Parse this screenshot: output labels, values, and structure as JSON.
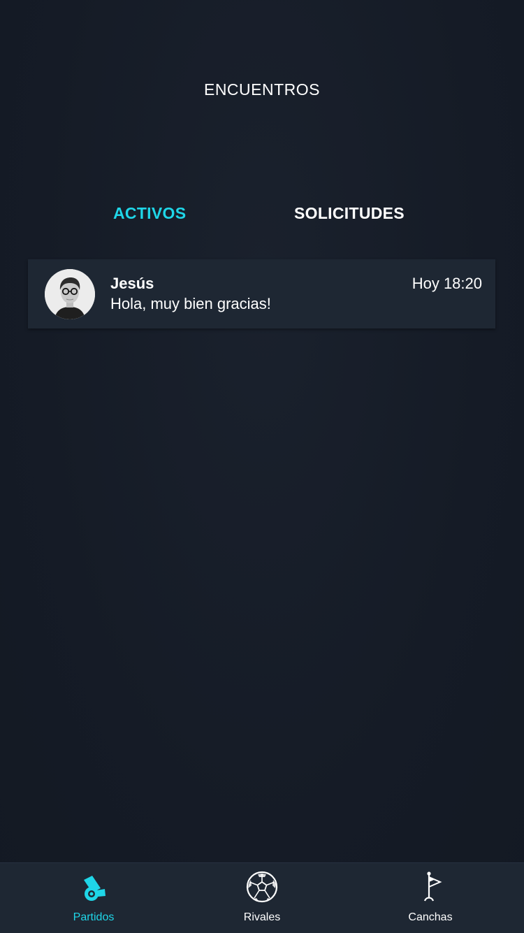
{
  "header": {
    "title": "ENCUENTROS"
  },
  "tabs": [
    {
      "label": "ACTIVOS",
      "active": true
    },
    {
      "label": "SOLICITUDES",
      "active": false
    }
  ],
  "conversations": [
    {
      "name": "Jesús",
      "message": "Hola, muy bien gracias!",
      "time": "Hoy 18:20"
    }
  ],
  "bottom_nav": {
    "items": [
      {
        "label": "Partidos",
        "icon": "whistle-icon",
        "active": true
      },
      {
        "label": "Rivales",
        "icon": "soccer-ball-icon",
        "active": false
      },
      {
        "label": "Canchas",
        "icon": "corner-flag-icon",
        "active": false
      }
    ]
  },
  "colors": {
    "background": "#151b26",
    "surface": "#1e2733",
    "accent": "#1fd6e8",
    "text": "#ffffff"
  }
}
